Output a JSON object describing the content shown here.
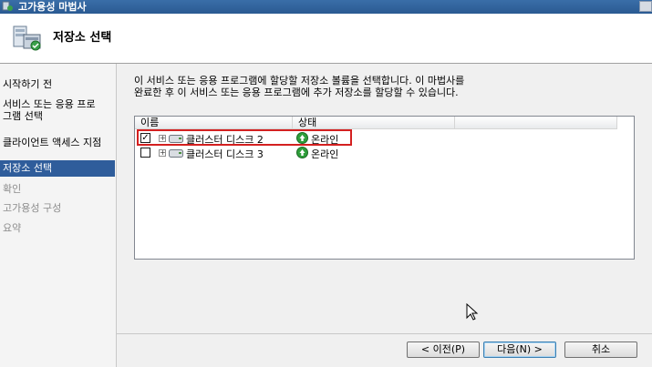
{
  "window": {
    "title": "고가용성 마법사"
  },
  "header": {
    "title": "저장소 선택"
  },
  "sidebar": {
    "items": [
      {
        "label": "시작하기 전",
        "state": "normal"
      },
      {
        "label": "서비스 또는 응용 프로\n그램 선택",
        "state": "normal"
      },
      {
        "label": "클라이언트 액세스 지점",
        "state": "normal"
      },
      {
        "label": "저장소 선택",
        "state": "active"
      },
      {
        "label": "확인",
        "state": "disabled"
      },
      {
        "label": "고가용성 구성",
        "state": "disabled"
      },
      {
        "label": "요약",
        "state": "disabled"
      }
    ]
  },
  "main": {
    "description": "이 서비스 또는 응용 프로그램에 할당할 저장소 볼륨을 선택합니다. 이 마법사를\n완료한 후 이 서비스 또는 응용 프로그램에 추가 저장소를 할당할 수 있습니다.",
    "columns": [
      "이름",
      "상태"
    ],
    "rows": [
      {
        "name": "클러스터 디스크 2",
        "status": "온라인",
        "checked": true
      },
      {
        "name": "클러스터 디스크 3",
        "status": "온라인",
        "checked": false
      }
    ]
  },
  "buttons": {
    "prev": "< 이전(P)",
    "next": "다음(N) >",
    "cancel": "취소"
  },
  "colors": {
    "accent": "#2f5d9b",
    "highlight": "#d42020",
    "status_online": "#2e9e3a"
  }
}
